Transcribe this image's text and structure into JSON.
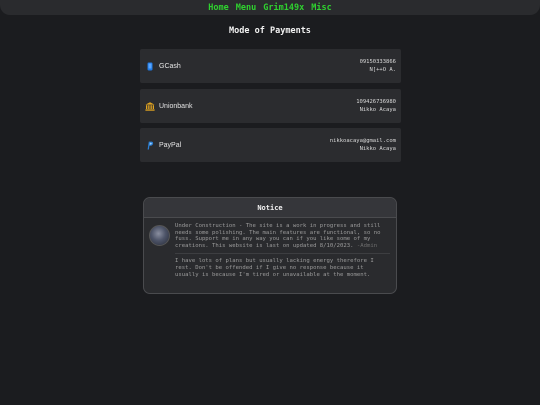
{
  "nav": {
    "items": [
      {
        "label": "Home"
      },
      {
        "label": "Menu"
      },
      {
        "label": "Grim149x"
      },
      {
        "label": "Misc"
      }
    ]
  },
  "page": {
    "title": "Mode of Payments"
  },
  "payments": [
    {
      "name": "GCash",
      "icon": "wallet-icon",
      "line1": "09150333866",
      "line2": "N[++O A."
    },
    {
      "name": "Unionbank",
      "icon": "bank-icon",
      "line1": "109426736980",
      "line2": "Nikko Acaya"
    },
    {
      "name": "PayPal",
      "icon": "paypal-icon",
      "line1": "nikkoacaya@gmail.com",
      "line2": "Nikko Acaya"
    }
  ],
  "notice": {
    "title": "Notice",
    "paragraph1": "Under Construction - The site is a work in progress and still needs some polishing. The main features are functional, so no fuss. Support me in any way you can if you like some of my creations. This website is last on updated 8/10/2023.",
    "paragraph1_signature": "-Admin",
    "paragraph2": "I have lots of plans but usually lacking energy therefore I rest. Don't be offended if I give no response because it usually is because I'm tired or unavailable at the moment."
  },
  "colors": {
    "background": "#1b1c1f",
    "nav_link": "#2fd12f",
    "card": "#2b2c2f",
    "gcash_blue": "#1e7ae6",
    "unionbank_gold": "#e2a521",
    "paypal_blue": "#2a7fd4"
  }
}
